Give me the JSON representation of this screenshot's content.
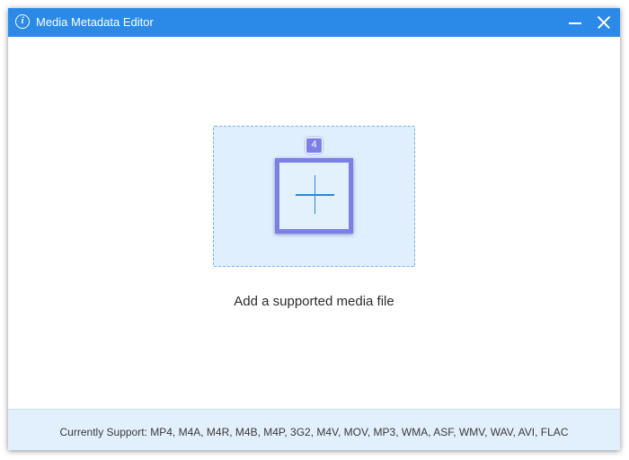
{
  "window": {
    "title": "Media Metadata Editor",
    "title_icon": "info-icon",
    "title_icon_glyph": "i",
    "accent_color": "#2b8ae8"
  },
  "titlebar_controls": {
    "minimize_icon": "minimize-icon",
    "close_icon": "close-icon"
  },
  "main": {
    "badge_number": "4",
    "add_icon": "plus-icon",
    "add_label": "Add a supported media file",
    "highlight_color": "#7b7fe6",
    "dropzone_color": "#dfeffd"
  },
  "footer": {
    "support_text": "Currently Support: MP4, M4A, M4R, M4B, M4P, 3G2, M4V, MOV, MP3, WMA, ASF, WMV, WAV, AVI, FLAC"
  }
}
